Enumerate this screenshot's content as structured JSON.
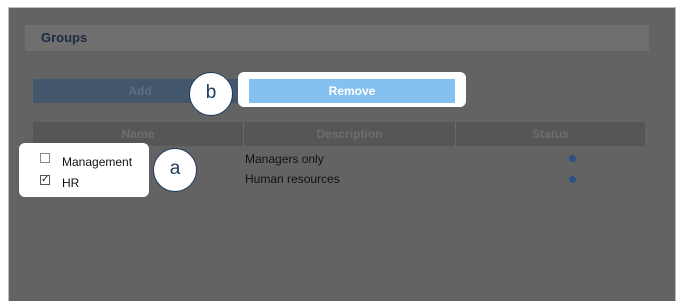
{
  "panel": {
    "title": "Groups"
  },
  "actions": {
    "add_label": "Add",
    "remove_label": "Remove"
  },
  "table": {
    "columns": [
      "Name",
      "Description",
      "Status"
    ],
    "rows": [
      {
        "name": "Management",
        "description": "Managers only",
        "checked": false
      },
      {
        "name": "HR",
        "description": "Human resources",
        "checked": true
      }
    ]
  },
  "callouts": {
    "a": "a",
    "b": "b"
  },
  "colors": {
    "accent": "#84c1f0",
    "status_dot": "#2f4f86",
    "callout_border": "#1e3a5f"
  }
}
